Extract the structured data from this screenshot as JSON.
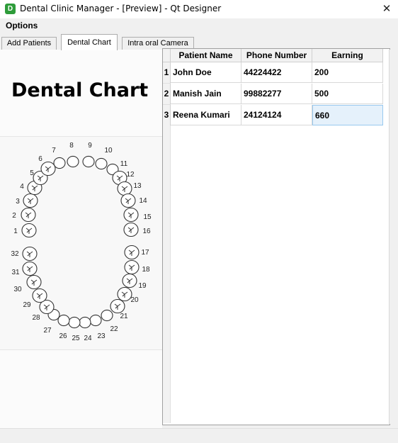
{
  "window": {
    "title": "Dental Clinic Manager - [Preview] - Qt Designer",
    "icon_letter": "D",
    "close_label": "✕"
  },
  "menu": {
    "options_label": "Options"
  },
  "tabs": [
    {
      "label": "Add Patients"
    },
    {
      "label": "Dental Chart"
    },
    {
      "label": "Intra oral Camera"
    }
  ],
  "page": {
    "heading": "Dental Chart"
  },
  "chart": {
    "tooth_numbers": [
      "1",
      "2",
      "3",
      "4",
      "5",
      "6",
      "7",
      "8",
      "9",
      "10",
      "11",
      "12",
      "13",
      "14",
      "15",
      "16",
      "17",
      "18",
      "19",
      "20",
      "21",
      "22",
      "23",
      "24",
      "25",
      "26",
      "27",
      "28",
      "29",
      "30",
      "31",
      "32"
    ]
  },
  "table": {
    "columns": [
      "Patient Name",
      "Phone Number",
      "Earning"
    ],
    "rows": [
      {
        "index": "1",
        "name": "John Doe",
        "phone": "44224422",
        "earning": "200"
      },
      {
        "index": "2",
        "name": "Manish Jain",
        "phone": "99882277",
        "earning": "500"
      },
      {
        "index": "3",
        "name": "Reena Kumari",
        "phone": "24124124",
        "earning": "660"
      }
    ]
  }
}
